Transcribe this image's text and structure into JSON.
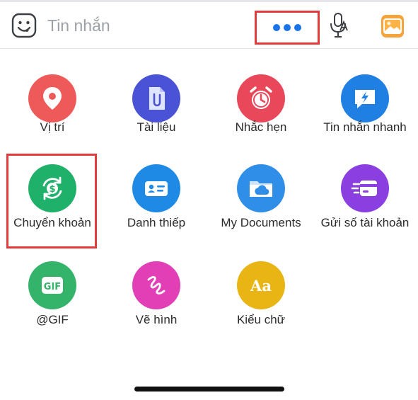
{
  "composer": {
    "placeholder": "Tin nhắn",
    "icons": [
      "emoji-icon",
      "more-dots-icon",
      "voice-to-text-icon",
      "photo-gallery-icon"
    ]
  },
  "menu": {
    "items": [
      {
        "label": "Vị trí",
        "icon": "location-pin-icon",
        "color": "#ee5a5a"
      },
      {
        "label": "Tài liệu",
        "icon": "paperclip-document-icon",
        "color": "#4a52d6"
      },
      {
        "label": "Nhắc hẹn",
        "icon": "alarm-clock-icon",
        "color": "#e9475a"
      },
      {
        "label": "Tin nhắn nhanh",
        "icon": "quick-message-lightning-icon",
        "color": "#1f7fe3"
      },
      {
        "label": "Chuyển khoản",
        "icon": "money-transfer-icon",
        "color": "#1fb06a"
      },
      {
        "label": "Danh thiếp",
        "icon": "business-card-icon",
        "color": "#1f8ae6"
      },
      {
        "label": "My Documents",
        "icon": "cloud-folder-icon",
        "color": "#2f8fe8"
      },
      {
        "label": "Gửi số tài khoản",
        "icon": "bank-card-icon",
        "color": "#8b3fe0"
      },
      {
        "label": "@GIF",
        "icon": "gif-icon",
        "color": "#34b36a"
      },
      {
        "label": "Vẽ hình",
        "icon": "drawing-scribble-icon",
        "color": "#e23fb6"
      },
      {
        "label": "Kiểu chữ",
        "icon": "font-style-icon",
        "color": "#e9b515"
      }
    ]
  },
  "colors": {
    "highlight": "#e23b3b",
    "accent": "#1a73e8"
  }
}
